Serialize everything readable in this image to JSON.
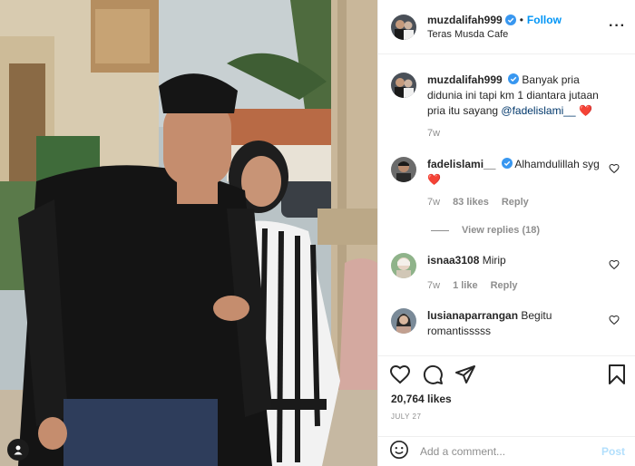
{
  "post": {
    "username": "muzdalifah999",
    "follow_label": "Follow",
    "location": "Teras Musda Cafe",
    "more_label": "···"
  },
  "caption": {
    "username": "muzdalifah999",
    "text": "Banyak pria didunia ini tapi km 1 diantara jutaan pria itu sayang",
    "mention": "@fadelislami__",
    "emoji": "❤️",
    "time": "7w"
  },
  "comments": [
    {
      "username": "fadelislami__",
      "text": "Alhamdulillah syg",
      "emoji": "❤️",
      "time": "7w",
      "likes": "83 likes",
      "reply_label": "Reply",
      "view_replies": "View replies (18)"
    },
    {
      "username": "isnaa3108",
      "text": "Mirip",
      "time": "7w",
      "likes": "1 like",
      "reply_label": "Reply"
    },
    {
      "username": "lusianaparrangan",
      "text": "Begitu romantisssss"
    }
  ],
  "stats": {
    "likes": "20,764 likes",
    "date": "JULY 27"
  },
  "composer": {
    "placeholder": "Add a comment...",
    "post_label": "Post"
  },
  "colors": {
    "accent": "#0095f6",
    "verified": "#3897f0",
    "heart": "#ed4956",
    "muted": "#8e8e8e",
    "post_disabled": "#b2dffc"
  },
  "icons": [
    "verified-badge-icon",
    "heart-icon",
    "comment-icon",
    "share-icon",
    "bookmark-icon",
    "emoji-icon",
    "user-tag-icon"
  ]
}
